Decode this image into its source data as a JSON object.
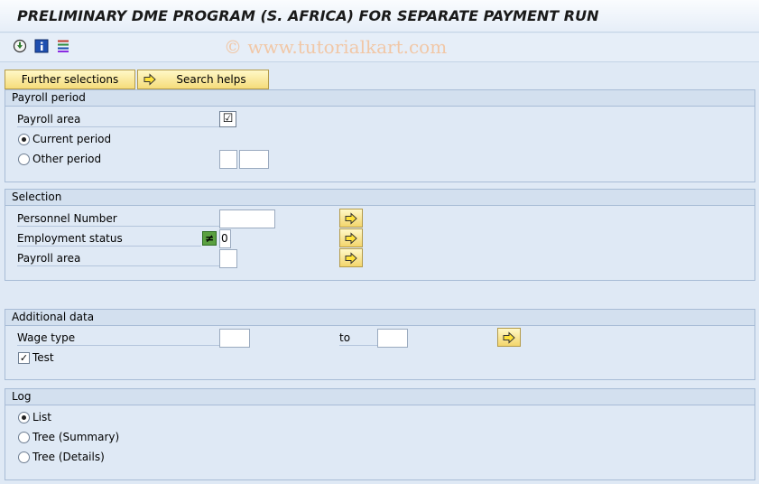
{
  "window": {
    "title": "PRELIMINARY DME PROGRAM (S. AFRICA) FOR SEPARATE PAYMENT RUN",
    "watermark": "© www.tutorialkart.com"
  },
  "toolbar": {
    "icons": [
      "execute-icon",
      "info-icon",
      "variants-icon"
    ],
    "further_selections": "Further selections",
    "search_helps": "Search helps"
  },
  "payroll_period": {
    "header": "Payroll period",
    "payroll_area_label": "Payroll area",
    "payroll_area_checked": "☑",
    "current_period_label": "Current period",
    "other_period_label": "Other period",
    "selected": "current"
  },
  "selection": {
    "header": "Selection",
    "personnel_number_label": "Personnel Number",
    "personnel_number_value": "",
    "employment_status_label": "Employment status",
    "employment_status_operator": "≠",
    "employment_status_value": "0",
    "payroll_area_label": "Payroll area",
    "payroll_area_value": ""
  },
  "additional_data": {
    "header": "Additional data",
    "wage_type_label": "Wage type",
    "wage_type_from": "",
    "to_label": "to",
    "wage_type_to": "",
    "test_label": "Test",
    "test_checked": "✓"
  },
  "log": {
    "header": "Log",
    "options": [
      "List",
      "Tree (Summary)",
      "Tree (Details)"
    ],
    "selected": "List"
  },
  "colors": {
    "background": "#dfe9f5",
    "button_yellow": "#f5dc7a",
    "group_border": "#a8bcd6"
  }
}
